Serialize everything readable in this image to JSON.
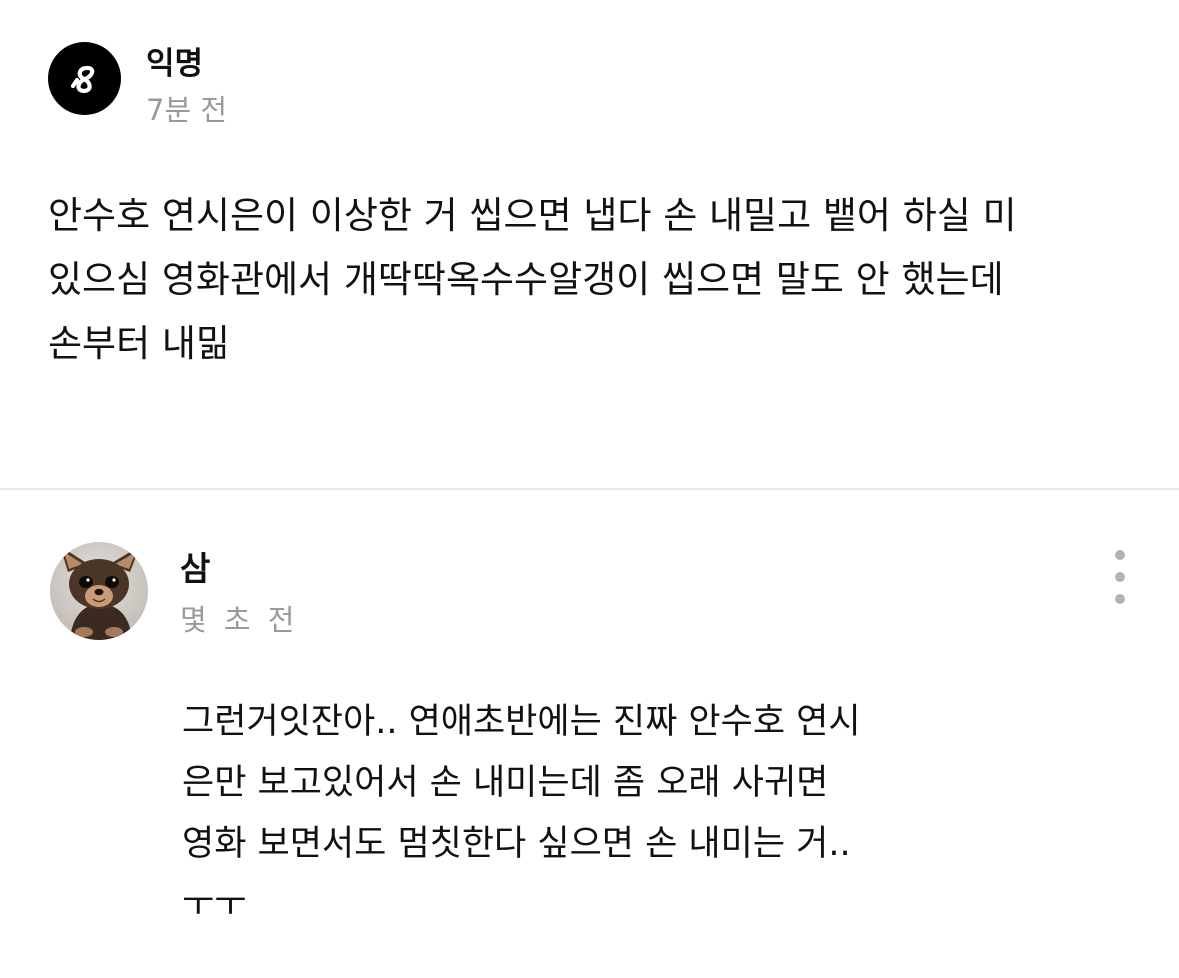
{
  "post": {
    "author": "익명",
    "time": "7분 전",
    "lines": [
      "안수호 연시은이 이상한 거 씹으면 냅다 손 내밀고 뱉어 하실 미",
      "있으심 영화관에서 개딱딱옥수수알갱이 씹으면 말도 안 했는데",
      "손부터 내밂"
    ],
    "avatar_icon": "logo-icon"
  },
  "comment": {
    "author": "삼",
    "time": "몇 초 전",
    "avatar_image": "chihuahua-photo",
    "more_icon": "more-vertical-icon",
    "lines": [
      "그런거잇잔아.. 연애초반에는 진짜 안수호 연시",
      "은만 보고있어서 손 내미는데 좀 오래 사귀면",
      "영화 보면서도 멈칫한다 싶으면 손 내미는 거..",
      "ㅜㅜ"
    ]
  },
  "colors": {
    "text": "#111111",
    "muted": "#9a9a9a",
    "divider": "#e8e8e8",
    "avatar_bg": "#000000",
    "more_dots": "#b3b3b3"
  }
}
